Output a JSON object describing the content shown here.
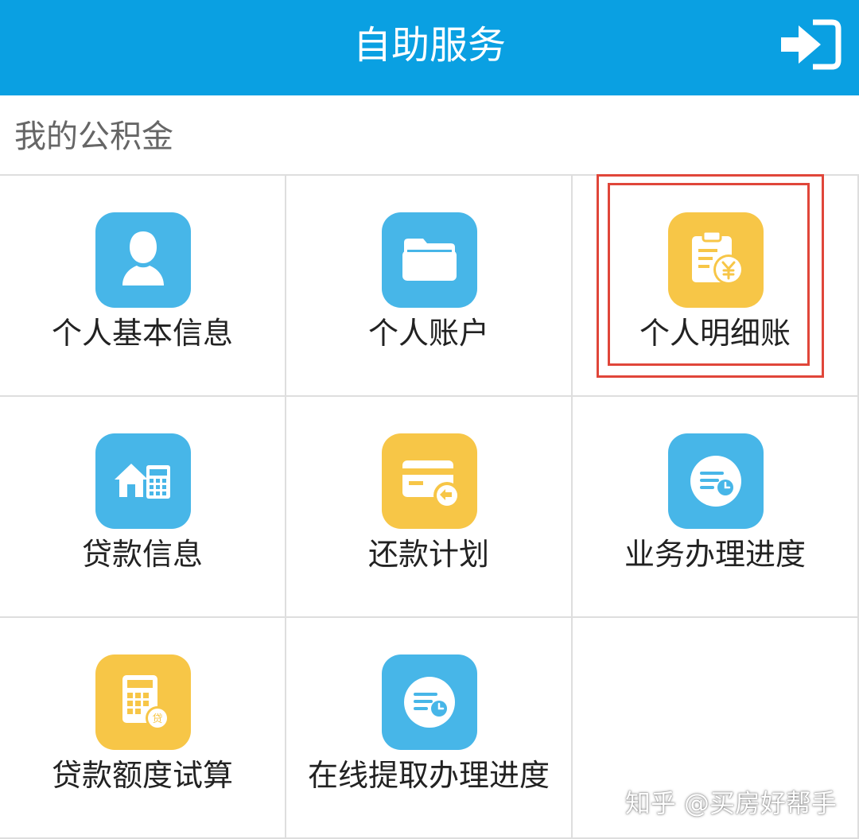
{
  "header": {
    "title": "自助服务"
  },
  "section": {
    "title": "我的公积金"
  },
  "colors": {
    "header_bg": "#0aa0e2",
    "blue_tile": "#47b6e8",
    "yellow_tile": "#f7c647",
    "highlight": "#e0463a"
  },
  "tiles": [
    {
      "label": "个人基本信息",
      "icon": "user-icon",
      "color": "blue"
    },
    {
      "label": "个人账户",
      "icon": "folder-icon",
      "color": "blue"
    },
    {
      "label": "个人明细账",
      "icon": "ledger-yen-icon",
      "color": "yellow",
      "highlighted": true
    },
    {
      "label": "贷款信息",
      "icon": "house-calculator-icon",
      "color": "blue"
    },
    {
      "label": "还款计划",
      "icon": "card-repay-icon",
      "color": "yellow"
    },
    {
      "label": "业务办理进度",
      "icon": "progress-clock-icon",
      "color": "blue"
    },
    {
      "label": "贷款额度试算",
      "icon": "loan-calculator-icon",
      "color": "yellow"
    },
    {
      "label": "在线提取办理进度",
      "icon": "progress-clock-icon",
      "color": "blue"
    }
  ],
  "watermark": {
    "text": "知乎 @买房好帮手"
  }
}
